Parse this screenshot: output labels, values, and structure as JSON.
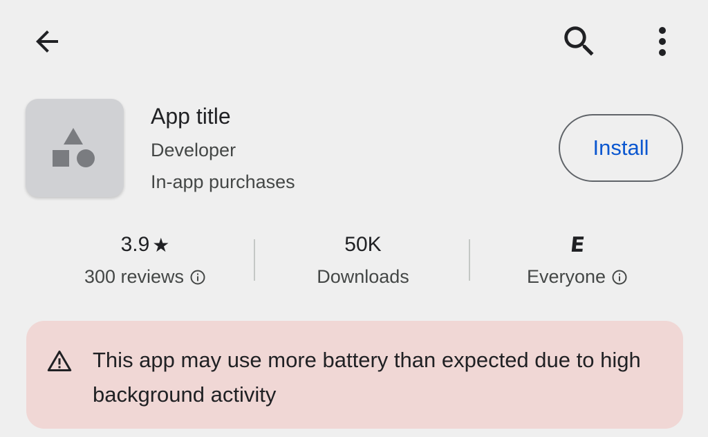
{
  "topbar": {
    "back_icon": "arrow-back-icon",
    "search_icon": "search-icon",
    "more_icon": "more-vert-icon"
  },
  "app": {
    "icon": "app-placeholder-icon",
    "title": "App title",
    "developer": "Developer",
    "in_app_purchases": "In-app purchases",
    "install_label": "Install"
  },
  "stats": {
    "rating": {
      "value": "3.9",
      "star": "★",
      "label": "300 reviews"
    },
    "downloads": {
      "value": "50K",
      "label": "Downloads"
    },
    "content_rating": {
      "badge": "E",
      "label": "Everyone"
    }
  },
  "warning": {
    "icon": "warning-icon",
    "text": "This app may use more battery than expected due to high background activity"
  },
  "colors": {
    "background": "#efefef",
    "accent": "#0b57d0",
    "warning_bg": "#f0d7d5",
    "icon_bg": "#d0d1d4"
  }
}
